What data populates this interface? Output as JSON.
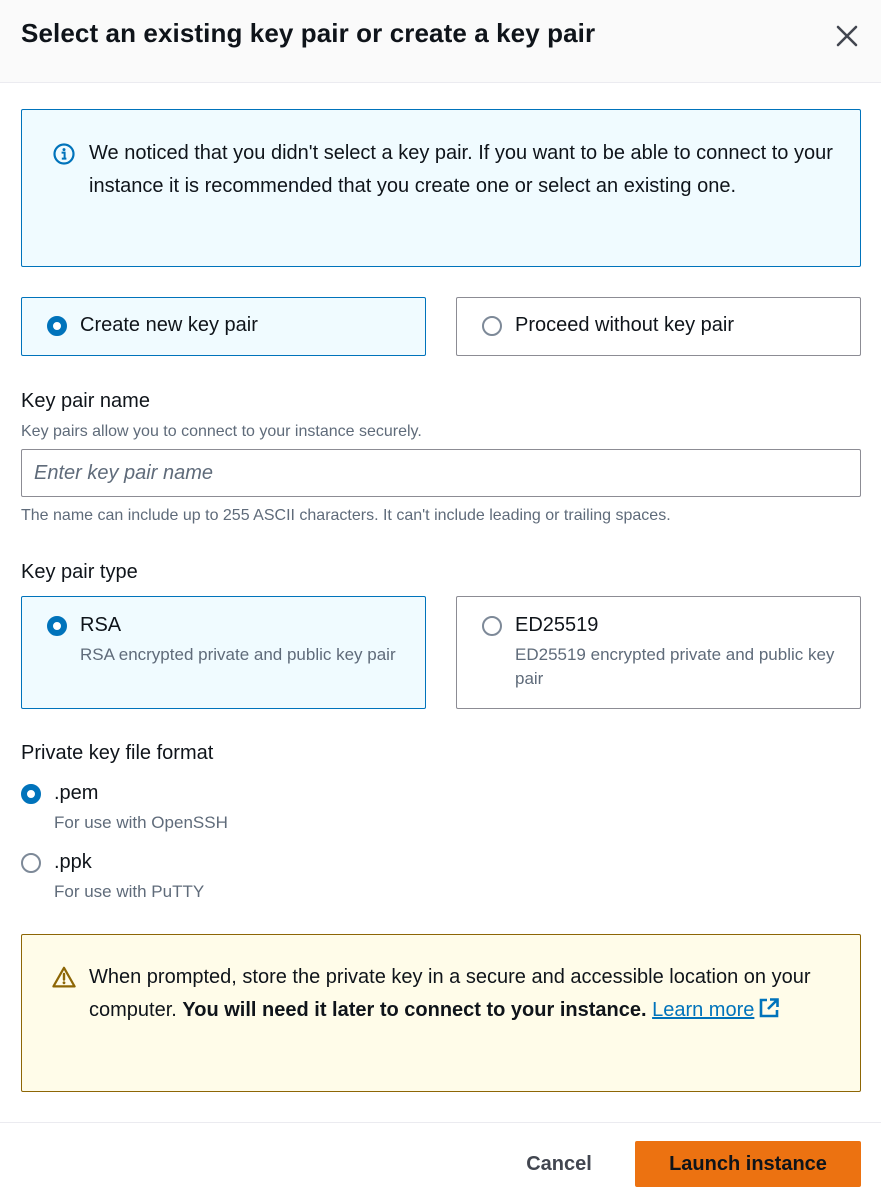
{
  "header": {
    "title": "Select an existing key pair or create a key pair",
    "close_icon": "close-icon"
  },
  "info_alert": {
    "icon": "info-icon",
    "text": "We noticed that you didn't select a key pair. If you want to be able to connect to your instance it is recommended that you create one or select an existing one.",
    "color": "#0073bb"
  },
  "key_pair_choice": {
    "options": [
      {
        "label": "Create new key pair",
        "selected": true
      },
      {
        "label": "Proceed without key pair",
        "selected": false
      }
    ]
  },
  "key_pair_name": {
    "label": "Key pair name",
    "description": "Key pairs allow you to connect to your instance securely.",
    "placeholder": "Enter key pair name",
    "value": "",
    "constraint": "The name can include up to 255 ASCII characters. It can't include leading or trailing spaces."
  },
  "key_pair_type": {
    "label": "Key pair type",
    "options": [
      {
        "label": "RSA",
        "description": "RSA encrypted private and public key pair",
        "selected": true
      },
      {
        "label": "ED25519",
        "description": "ED25519 encrypted private and public key pair",
        "selected": false
      }
    ]
  },
  "private_key_format": {
    "label": "Private key file format",
    "options": [
      {
        "label": ".pem",
        "description": "For use with OpenSSH",
        "selected": true
      },
      {
        "label": ".ppk",
        "description": "For use with PuTTY",
        "selected": false
      }
    ]
  },
  "warning_alert": {
    "icon": "warning-icon",
    "text": "When prompted, store the private key in a secure and accessible location on your computer.",
    "bold_text": "You will need it later to connect to your instance.",
    "link_text": "Learn more",
    "link_icon": "external-link-icon",
    "color": "#8d6605"
  },
  "footer": {
    "cancel_label": "Cancel",
    "launch_label": "Launch instance",
    "accent": "#ec7211"
  }
}
